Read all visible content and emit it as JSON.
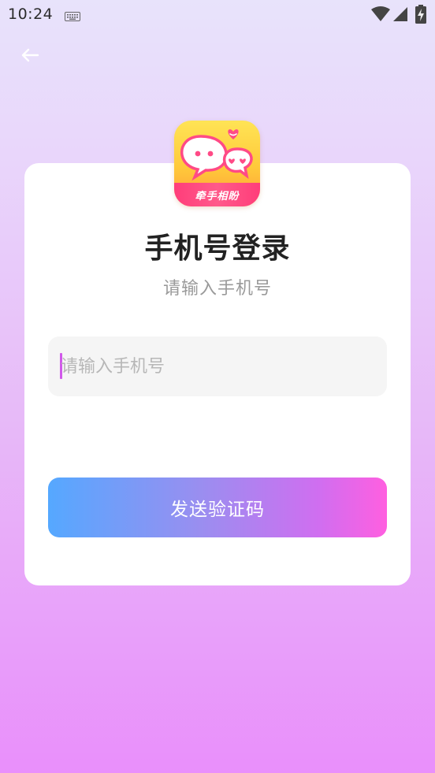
{
  "status_bar": {
    "time": "10:24",
    "icons": [
      "keyboard-icon",
      "wifi-icon",
      "signal-icon",
      "battery-charging-icon"
    ]
  },
  "nav": {
    "back_icon": "arrow-left-icon"
  },
  "app": {
    "logo_text": "牵手相盼"
  },
  "login": {
    "title": "手机号登录",
    "subtitle": "请输入手机号",
    "phone_placeholder": "请输入手机号",
    "phone_value": "",
    "send_code_label": "发送验证码"
  },
  "colors": {
    "button_gradient_start": "#55a8ff",
    "button_gradient_end": "#ff5fe0",
    "caret": "#d158ea",
    "logo_band": "#ff3d7a"
  }
}
